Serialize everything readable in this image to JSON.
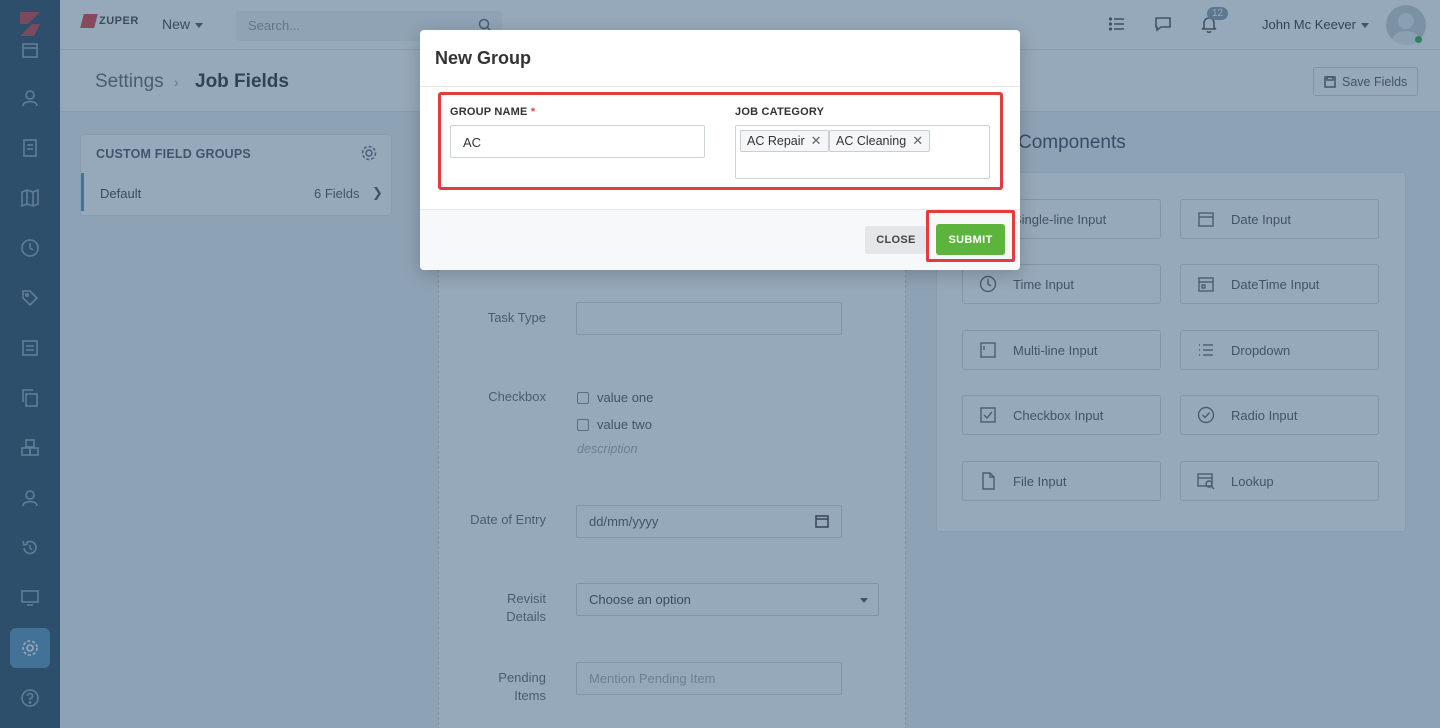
{
  "brand": {
    "name": "ZUPER"
  },
  "topnav": {
    "new_label": "New",
    "search_placeholder": "Search...",
    "notification_count": "12",
    "user_name": "John Mc Keever"
  },
  "breadcrumb": {
    "parent": "Settings",
    "separator": "›",
    "current": "Job Fields"
  },
  "header": {
    "save_label": "Save Fields"
  },
  "custom_field_groups": {
    "title": "CUSTOM FIELD GROUPS",
    "items": [
      {
        "name": "Default",
        "count": "6 Fields"
      }
    ]
  },
  "form_preview": {
    "task_type_label": "Task Type",
    "checkbox_label": "Checkbox",
    "checkbox_options": [
      "value one",
      "value two"
    ],
    "checkbox_description": "description",
    "date_label": "Date of Entry",
    "date_placeholder": "dd/mm/yyyy",
    "revisit_label_1": "Revisit",
    "revisit_label_2": "Details",
    "revisit_placeholder": "Choose an option",
    "pending_label_1": "Pending",
    "pending_label_2": "Items",
    "pending_placeholder": "Mention Pending Item"
  },
  "components": {
    "title": "Components",
    "items": [
      {
        "label": "Single-line Input",
        "icon": "text-input-icon"
      },
      {
        "label": "Date Input",
        "icon": "calendar-icon"
      },
      {
        "label": "Time Input",
        "icon": "clock-icon"
      },
      {
        "label": "DateTime Input",
        "icon": "calendar-clock-icon"
      },
      {
        "label": "Multi-line Input",
        "icon": "textarea-icon"
      },
      {
        "label": "Dropdown",
        "icon": "list-icon"
      },
      {
        "label": "Checkbox Input",
        "icon": "checkbox-icon"
      },
      {
        "label": "Radio Input",
        "icon": "radio-icon"
      },
      {
        "label": "File Input",
        "icon": "file-icon"
      },
      {
        "label": "Lookup",
        "icon": "lookup-icon"
      }
    ]
  },
  "modal": {
    "title": "New Group",
    "group_name_label": "GROUP NAME",
    "required_mark": "*",
    "group_name_value": "AC",
    "job_category_label": "JOB CATEGORY",
    "job_categories": [
      "AC Repair",
      "AC Cleaning"
    ],
    "chip_remove": "✕",
    "close_label": "CLOSE",
    "submit_label": "SUBMIT"
  },
  "colors": {
    "sidebar_bg": "#2e4a62",
    "accent": "#5890b8",
    "submit_green": "#5cb43c",
    "highlight_red": "#e23c3c"
  }
}
